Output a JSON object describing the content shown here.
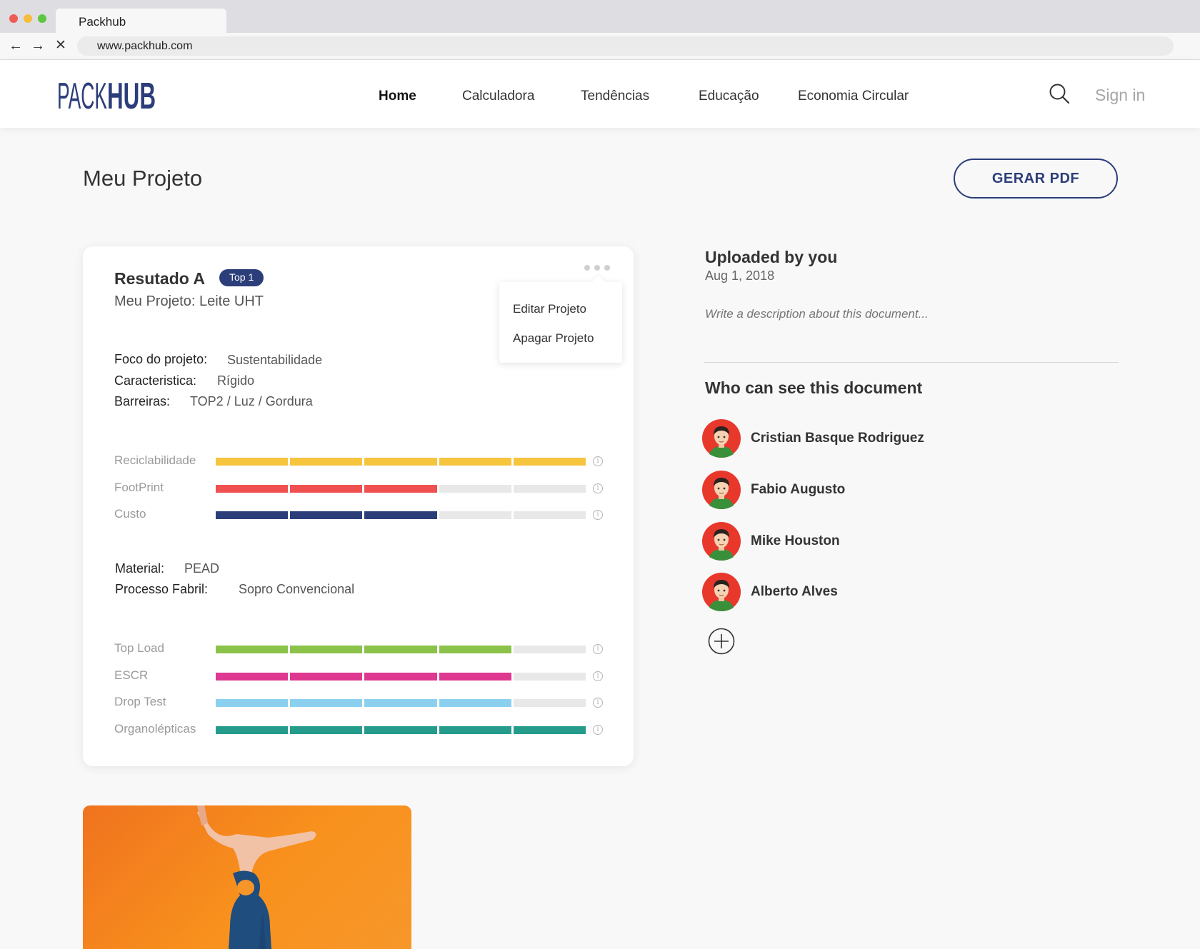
{
  "browser": {
    "tab_title": "Packhub",
    "url": "www.packhub.com"
  },
  "header": {
    "logo_text": "PACKHUB",
    "nav": [
      "Home",
      "Calculadora",
      "Tendências",
      "Educação",
      "Economia Circular"
    ],
    "active_nav": "Home",
    "signin_label": "Sign in"
  },
  "page": {
    "title": "Meu Projeto",
    "pdf_button": "GERAR PDF"
  },
  "card": {
    "title": "Resutado A",
    "badge": "Top 1",
    "subtitle": "Meu Projeto: Leite UHT",
    "menu": [
      "Editar Projeto",
      "Apagar Projeto"
    ],
    "details": [
      {
        "key": "Foco do projeto:",
        "value": "Sustentabilidade"
      },
      {
        "key": "Caracteristica:",
        "value": "Rígido"
      },
      {
        "key": "Barreiras:",
        "value": "TOP2 / Luz / Gordura"
      }
    ],
    "bars_group1": [
      {
        "label": "Reciclabilidade",
        "level": 5,
        "max": 5,
        "color": "#f7c43e"
      },
      {
        "label": "FootPrint",
        "level": 3,
        "max": 5,
        "color": "#ef5151"
      },
      {
        "label": "Custo",
        "level": 3,
        "max": 5,
        "color": "#2c3e7a"
      }
    ],
    "material": [
      {
        "key": "Material:",
        "value": "PEAD"
      },
      {
        "key": "Processo Fabril:",
        "value": "Sopro Convencional"
      }
    ],
    "bars_group2": [
      {
        "label": "Top Load",
        "level": 4,
        "max": 5,
        "color": "#8bc34a"
      },
      {
        "label": "ESCR",
        "level": 4,
        "max": 5,
        "color": "#de3891"
      },
      {
        "label": "Drop Test",
        "level": 4,
        "max": 5,
        "color": "#8cd0ef"
      },
      {
        "label": "Organolépticas",
        "level": 5,
        "max": 5,
        "color": "#259c8b"
      }
    ],
    "info_symbol": "i"
  },
  "sidebar": {
    "uploaded_title": "Uploaded by you",
    "uploaded_date": "Aug 1, 2018",
    "description_placeholder": "Write a description about this document...",
    "share_title": "Who can see this document",
    "people": [
      "Cristian Basque Rodriguez",
      "Fabio Augusto",
      "Mike Houston",
      "Alberto Alves"
    ]
  },
  "colors": {
    "brand": "#2c3e7a",
    "avatar_bg": "#e8382c"
  }
}
